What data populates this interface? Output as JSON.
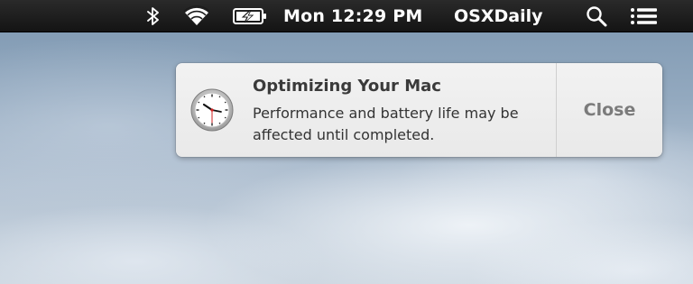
{
  "menubar": {
    "icons": {
      "bluetooth": "bluetooth-icon",
      "wifi": "wifi-icon",
      "battery": "battery-charging-icon",
      "spotlight": "spotlight-search-icon",
      "notification_center": "notification-center-icon"
    },
    "clock": "Mon 12:29 PM",
    "user": "OSXDaily"
  },
  "notification": {
    "icon": "clock-icon",
    "title": "Optimizing Your Mac",
    "body": "Performance and battery life may be affected until completed.",
    "close_label": "Close"
  },
  "colors": {
    "menubar_bg": "#1c1c1c",
    "menubar_text": "#ffffff",
    "banner_bg": "#efefef",
    "close_text": "#7b7b7b"
  }
}
